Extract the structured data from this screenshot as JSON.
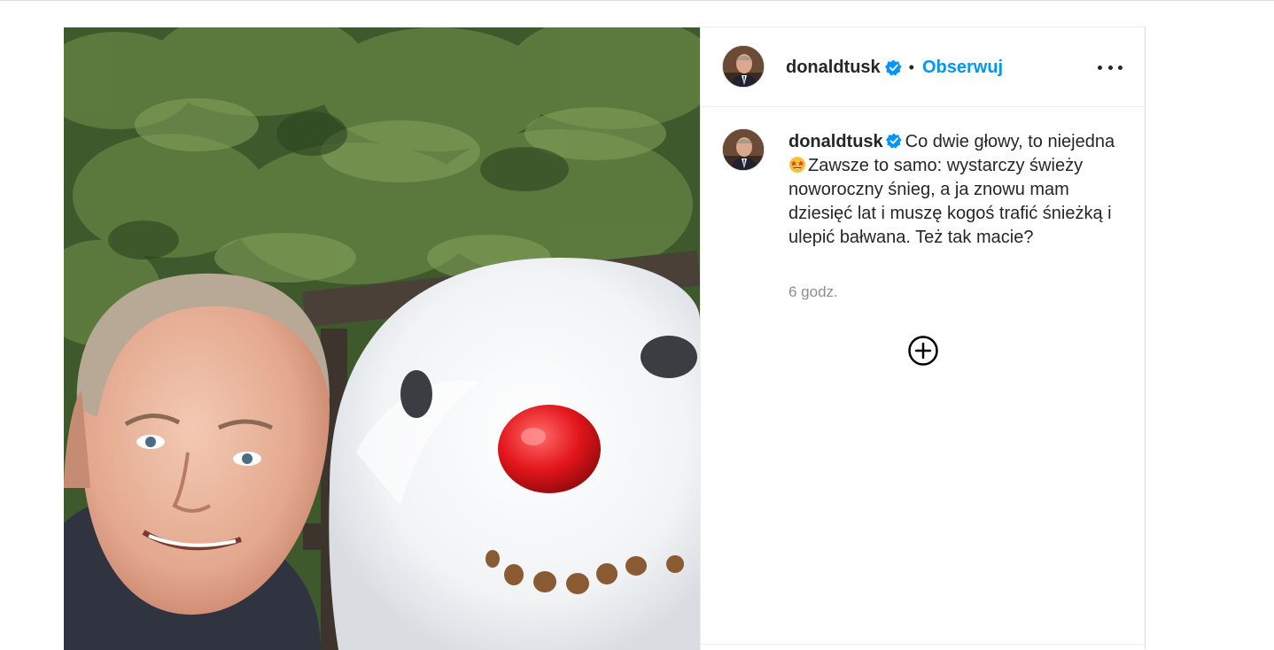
{
  "post": {
    "author": {
      "username": "donaldtusk",
      "verified": true,
      "verified_icon": "verified-badge-icon",
      "verified_color": "#0095f6"
    },
    "header": {
      "separator": "•",
      "follow_label": "Obserwuj",
      "more_icon": "more-options-icon"
    },
    "caption": {
      "username": "donaldtusk",
      "text_part1": "Co dwie głowy, to niejedna",
      "emoji": "star-struck-emoji",
      "text_part2": "Zawsze to samo: wystarczy świeży noworoczny śnieg, a ja znowu mam dziesięć lat i muszę kogoś trafić śnieżką i ulepić bałwana. Też tak macie?"
    },
    "timestamp": "6 godz.",
    "load_more_icon": "plus-circle-icon",
    "colors": {
      "accent": "#0095f6",
      "text": "#262626",
      "muted": "#8e8e8e",
      "border": "#dbdbdb"
    }
  }
}
